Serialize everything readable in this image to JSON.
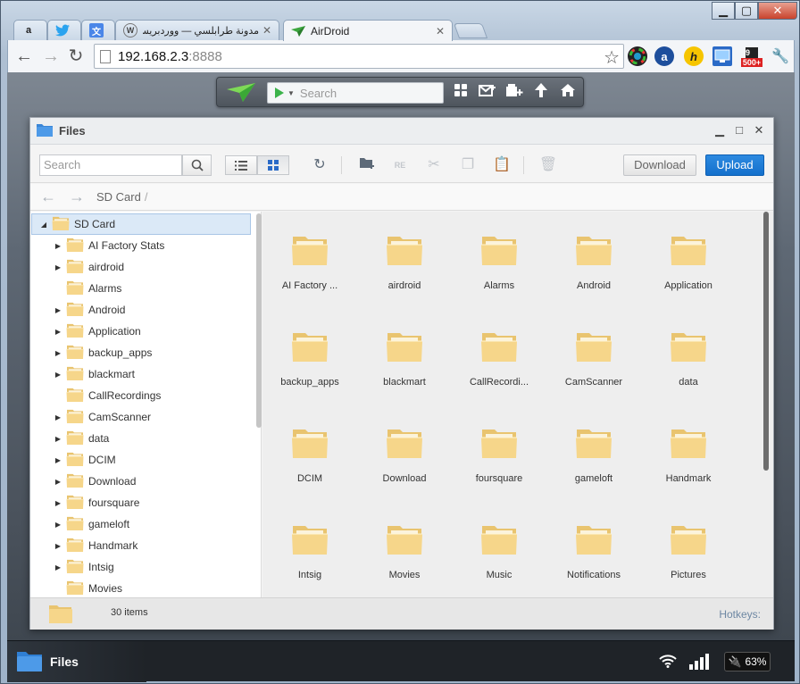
{
  "browser": {
    "tabs": [
      {
        "label": "",
        "icon": "amazon-icon"
      },
      {
        "label": "",
        "icon": "twitter-icon"
      },
      {
        "label": "",
        "icon": "translate-icon"
      },
      {
        "label": "مدونة طرابلسي — ووردبريس",
        "icon": "wordpress-icon"
      },
      {
        "label": "AirDroid",
        "icon": "airdroid-icon"
      }
    ],
    "address": {
      "host": "192.168.2.3",
      "port": ":8888"
    },
    "extensions": {
      "badge_top": "9",
      "badge_bottom": "500+"
    }
  },
  "airdroid_toolbar": {
    "search_placeholder": "Search"
  },
  "files_window": {
    "title": "Files",
    "search_placeholder": "Search",
    "download_label": "Download",
    "upload_label": "Upload",
    "breadcrumb": {
      "root": "SD Card",
      "separator": "/"
    },
    "tree": {
      "root": "SD Card",
      "items": [
        {
          "label": "AI Factory Stats",
          "expandable": true
        },
        {
          "label": "airdroid",
          "expandable": true
        },
        {
          "label": "Alarms",
          "expandable": false
        },
        {
          "label": "Android",
          "expandable": true
        },
        {
          "label": "Application",
          "expandable": true
        },
        {
          "label": "backup_apps",
          "expandable": true
        },
        {
          "label": "blackmart",
          "expandable": true
        },
        {
          "label": "CallRecordings",
          "expandable": false
        },
        {
          "label": "CamScanner",
          "expandable": true
        },
        {
          "label": "data",
          "expandable": true
        },
        {
          "label": "DCIM",
          "expandable": true
        },
        {
          "label": "Download",
          "expandable": true
        },
        {
          "label": "foursquare",
          "expandable": true
        },
        {
          "label": "gameloft",
          "expandable": true
        },
        {
          "label": "Handmark",
          "expandable": true
        },
        {
          "label": "Intsig",
          "expandable": true
        },
        {
          "label": "Movies",
          "expandable": false
        }
      ]
    },
    "grid": [
      "AI Factory ...",
      "airdroid",
      "Alarms",
      "Android",
      "Application",
      "backup_apps",
      "blackmart",
      "CallRecordi...",
      "CamScanner",
      "data",
      "DCIM",
      "Download",
      "foursquare",
      "gameloft",
      "Handmark",
      "Intsig",
      "Movies",
      "Music",
      "Notifications",
      "Pictures"
    ],
    "status": {
      "count": "30 items",
      "hotkeys": "Hotkeys:"
    }
  },
  "dock": {
    "app_label": "Files",
    "battery": "63%"
  },
  "colors": {
    "accent_blue": "#1470cc",
    "folder_yellow": "#f6d68a",
    "selected_row": "#dbe9f7"
  }
}
